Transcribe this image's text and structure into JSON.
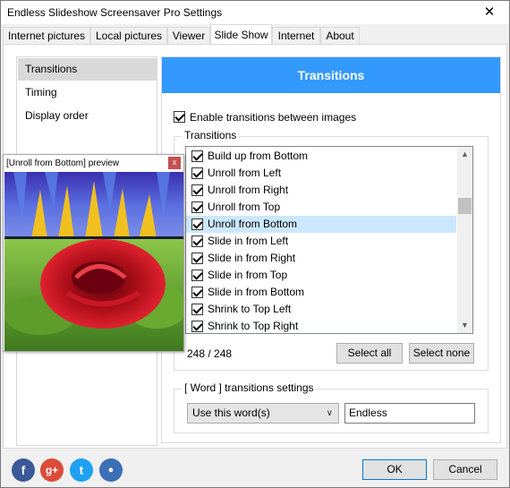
{
  "window": {
    "title": "Endless Slideshow Screensaver Pro Settings",
    "close_label": "✕"
  },
  "tabs": [
    {
      "label": "Internet pictures"
    },
    {
      "label": "Local pictures"
    },
    {
      "label": "Viewer"
    },
    {
      "label": "Slide Show",
      "active": true
    },
    {
      "label": "Internet"
    },
    {
      "label": "About"
    }
  ],
  "sidebar": {
    "items": [
      {
        "label": "Transitions",
        "selected": true
      },
      {
        "label": "Timing"
      },
      {
        "label": "Display order"
      }
    ]
  },
  "panel": {
    "banner": "Transitions",
    "enable_label": "Enable transitions between images",
    "enable_checked": true,
    "group_label": "Transitions",
    "transitions": [
      {
        "label": "Build up from Bottom",
        "checked": true
      },
      {
        "label": "Unroll from Left",
        "checked": true
      },
      {
        "label": "Unroll from Right",
        "checked": true
      },
      {
        "label": "Unroll from Top",
        "checked": true
      },
      {
        "label": "Unroll from Bottom",
        "checked": true,
        "highlighted": true
      },
      {
        "label": "Slide in from Left",
        "checked": true
      },
      {
        "label": "Slide in from Right",
        "checked": true
      },
      {
        "label": "Slide in from Top",
        "checked": true
      },
      {
        "label": "Slide in from Bottom",
        "checked": true
      },
      {
        "label": "Shrink to Top Left",
        "checked": true
      },
      {
        "label": "Shrink to Top Right",
        "checked": true
      }
    ],
    "count_text": "248 / 248",
    "select_all_label": "Select all",
    "select_none_label": "Select none",
    "word_group_label": "[ Word ] transitions settings",
    "word_mode_value": "Use this word(s)",
    "word_value": "Endless"
  },
  "preview": {
    "title": "[Unroll from Bottom] preview",
    "close_label": "x"
  },
  "footer": {
    "social": [
      {
        "icon": "facebook-icon",
        "glyph": "f",
        "color": "#3b5998"
      },
      {
        "icon": "google-plus-icon",
        "glyph": "g+",
        "color": "#dd4b39"
      },
      {
        "icon": "twitter-icon",
        "glyph": "t",
        "color": "#1da1f2"
      },
      {
        "icon": "community-icon",
        "glyph": "●",
        "color": "#3b6fb6"
      }
    ],
    "ok_label": "OK",
    "cancel_label": "Cancel"
  },
  "colors": {
    "accent": "#3399ff",
    "highlight": "#cce8ff"
  }
}
